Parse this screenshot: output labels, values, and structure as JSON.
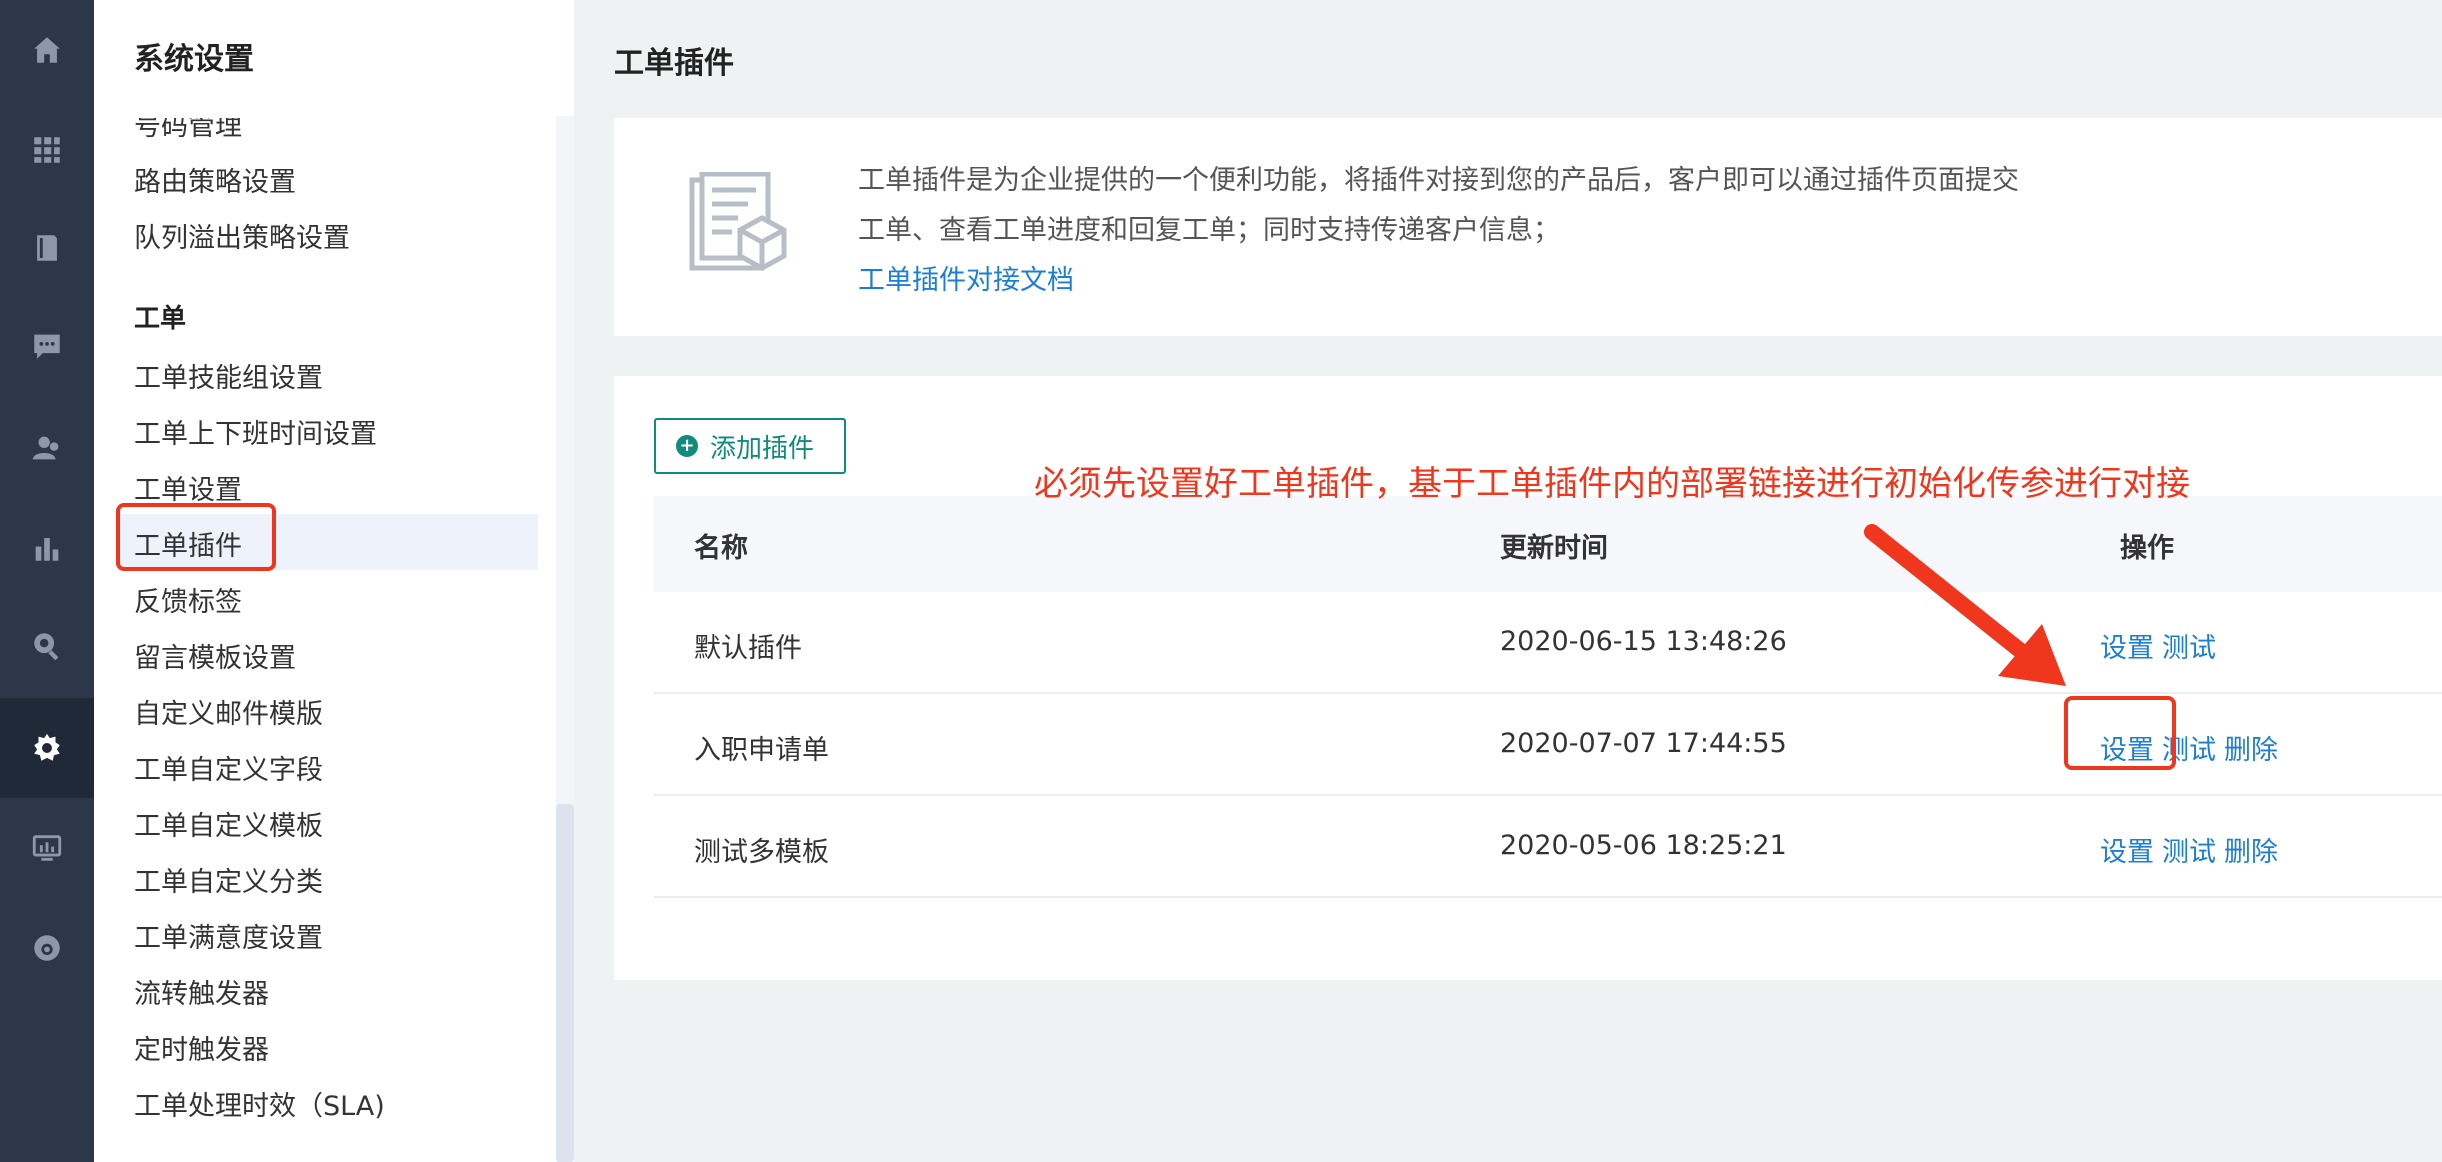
{
  "rail": {
    "items": [
      {
        "icon": "home-icon"
      },
      {
        "icon": "apps-icon"
      },
      {
        "icon": "book-icon"
      },
      {
        "icon": "chat-icon"
      },
      {
        "icon": "contacts-icon"
      },
      {
        "icon": "bar-chart-icon"
      },
      {
        "icon": "search-icon"
      },
      {
        "icon": "gear-icon",
        "active": true
      },
      {
        "icon": "monitor-icon"
      },
      {
        "icon": "camera-icon"
      }
    ]
  },
  "sidebar": {
    "title": "系统设置",
    "items_top": [
      "号码管理",
      "路由策略设置",
      "队列溢出策略设置"
    ],
    "section": "工单",
    "items": [
      "工单技能组设置",
      "工单上下班时间设置",
      "工单设置",
      "工单插件",
      "反馈标签",
      "留言模板设置",
      "自定义邮件模版",
      "工单自定义字段",
      "工单自定义模板",
      "工单自定义分类",
      "工单满意度设置",
      "流转触发器",
      "定时触发器",
      "工单处理时效（SLA)"
    ],
    "active_item": "工单插件"
  },
  "main": {
    "title": "工单插件",
    "info": {
      "line1": "工单插件是为企业提供的一个便利功能，将插件对接到您的产品后，客户即可以通过插件页面提交",
      "line2": "工单、查看工单进度和回复工单；同时支持传递客户信息；",
      "link": "工单插件对接文档"
    },
    "add_button": "添加插件",
    "table": {
      "headers": [
        "名称",
        "更新时间",
        "操作"
      ],
      "rows": [
        {
          "name": "默认插件",
          "time": "2020-06-15 13:48:26",
          "ops": [
            "设置",
            "测试"
          ]
        },
        {
          "name": "入职申请单",
          "time": "2020-07-07 17:44:55",
          "ops": [
            "设置",
            "测试",
            "删除"
          ]
        },
        {
          "name": "测试多模板",
          "time": "2020-05-06 18:25:21",
          "ops": [
            "设置",
            "测试",
            "删除"
          ]
        }
      ]
    }
  },
  "annotation": {
    "text": "必须先设置好工单插件，基于工单插件内的部署链接进行初始化传参进行对接",
    "color": "#f0361c"
  },
  "colors": {
    "rail_bg": "#2c3749",
    "accent": "#0f8c7c",
    "link": "#1c7fd6"
  }
}
